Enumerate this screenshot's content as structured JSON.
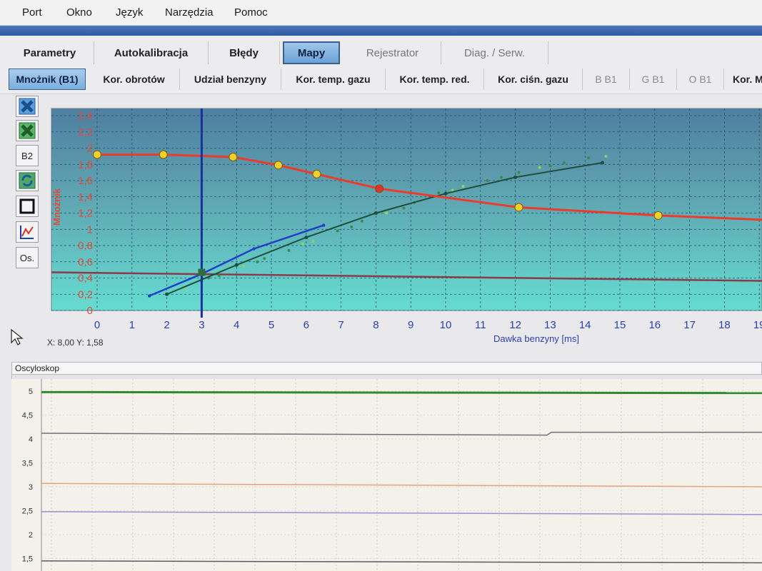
{
  "menu": [
    "Port",
    "Okno",
    "Język",
    "Narzędzia",
    "Pomoc"
  ],
  "main_tabs": [
    {
      "label": "Parametry"
    },
    {
      "label": "Autokalibracja"
    },
    {
      "label": "Błędy"
    },
    {
      "label": "Mapy"
    },
    {
      "label": "Rejestrator"
    },
    {
      "label": "Diag. / Serw."
    }
  ],
  "active_main_tab": "Mapy",
  "sub_tabs": [
    {
      "label": "Mnożnik (B1)"
    },
    {
      "label": "Kor. obrotów"
    },
    {
      "label": "Udział benzyny"
    },
    {
      "label": "Kor. temp. gazu"
    },
    {
      "label": "Kor. temp. red."
    },
    {
      "label": "Kor. ciśn. gazu"
    },
    {
      "label": "B B1"
    },
    {
      "label": "G B1"
    },
    {
      "label": "O B1"
    },
    {
      "label": "Kor. M"
    }
  ],
  "active_sub_tab": "Mnożnik (B1)",
  "toolbar": {
    "b2_label": "B2",
    "os_label": "Os.",
    "icons": [
      "blue-x-icon",
      "green-x-icon",
      "refresh-icon",
      "square-frame-icon",
      "chart-line-icon"
    ]
  },
  "coord_readout": "X: 8,00  Y: 1,58",
  "colors": {
    "multiplier_curve": "#ee3a2a",
    "control_point": "#f2d02a",
    "selected_point": "#e03030",
    "benzine_trend": "#1f4f3a",
    "gas_trend": "#2040c8",
    "cursor_line": "#1a2fa0",
    "threshold_line": "#8a3a4a",
    "osc_green": "#2e8b2e",
    "osc_gray": "#6f6f7a",
    "osc_orange": "#e4a47c",
    "osc_purple": "#9a8ed0"
  },
  "chart_data": [
    {
      "type": "line",
      "title": "",
      "xlabel": "Dawka benzyny [ms]",
      "ylabel": "Mnożnik",
      "xlim": [
        0,
        19
      ],
      "ylim": [
        0,
        2.4
      ],
      "x_ticks": [
        "0",
        "1",
        "2",
        "3",
        "4",
        "5",
        "6",
        "7",
        "8",
        "9",
        "10",
        "11",
        "12",
        "13",
        "14",
        "15",
        "16",
        "17",
        "18",
        "19"
      ],
      "y_ticks": [
        "0",
        "0,2",
        "0,4",
        "0,6",
        "0,8",
        "1",
        "1,2",
        "1,4",
        "1,6",
        "1,8",
        "2",
        "2,2",
        "2,4"
      ],
      "grid": true,
      "cursor_x": 3,
      "threshold_y": 0.47,
      "series": [
        {
          "role": "multiplier_map",
          "x": [
            0,
            1.9,
            3.9,
            5.2,
            6.3,
            8.1,
            12.1,
            16.1,
            19.5
          ],
          "y": [
            1.92,
            1.92,
            1.89,
            1.79,
            1.68,
            1.5,
            1.27,
            1.17,
            1.11
          ],
          "selected_index": 5
        },
        {
          "role": "benzine_trend",
          "x": [
            2,
            4,
            6,
            8,
            10,
            12,
            14.5
          ],
          "y": [
            0.2,
            0.56,
            0.9,
            1.2,
            1.44,
            1.64,
            1.82
          ]
        },
        {
          "role": "gas_trend",
          "x": [
            1.5,
            3,
            4.5,
            6.5
          ],
          "y": [
            0.18,
            0.45,
            0.76,
            1.05
          ]
        }
      ],
      "scatter_points": {
        "x": [
          2.5,
          3,
          3.5,
          4.2,
          4.8,
          5.5,
          6.2,
          6.9,
          7.6,
          8.3,
          9.1,
          9.8,
          10.5,
          11.2,
          12.1,
          12.7,
          13.4,
          14.1,
          14.6,
          3.2,
          4.6,
          5.9,
          7.3,
          8.8,
          10.2,
          11.6,
          13.0
        ],
        "y": [
          0.27,
          0.36,
          0.43,
          0.55,
          0.64,
          0.74,
          0.85,
          0.98,
          1.1,
          1.2,
          1.33,
          1.45,
          1.53,
          1.6,
          1.7,
          1.76,
          1.82,
          1.88,
          1.9,
          0.4,
          0.6,
          0.82,
          1.03,
          1.26,
          1.48,
          1.64,
          1.78
        ]
      }
    },
    {
      "type": "line",
      "title": "Oscyloskop",
      "ylim": [
        1.4,
        5
      ],
      "y_ticks": [
        "1,5",
        "2",
        "2,5",
        "3",
        "3,5",
        "4",
        "4,5",
        "5"
      ],
      "grid": true,
      "series": [
        {
          "role": "green_trace",
          "y": [
            4.98,
            4.96
          ]
        },
        {
          "role": "gray_trace",
          "y": [
            4.12,
            4.08,
            4.14
          ]
        },
        {
          "role": "orange_trace",
          "y": [
            3.07,
            3.0
          ]
        },
        {
          "role": "purple_trace",
          "y": [
            2.48,
            2.42
          ]
        },
        {
          "role": "dark_trace",
          "y": [
            1.45,
            1.41
          ]
        }
      ]
    }
  ]
}
